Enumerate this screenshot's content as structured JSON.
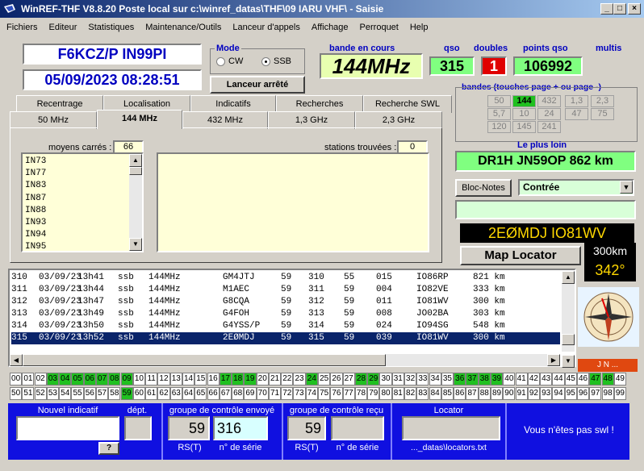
{
  "window": {
    "title": "WinREF-THF V8.8.20 Poste local sur c:\\winref_datas\\THF\\09 IARU VHF\\ -  Saisie"
  },
  "menu": [
    "Fichiers",
    "Editeur",
    "Statistiques",
    "Maintenance/Outils",
    "Lanceur d'appels",
    "Affichage",
    "Perroquet",
    "Help"
  ],
  "station": {
    "call_locator": "F6KCZ/P  IN99PI",
    "datetime": "05/09/2023  08:28:51"
  },
  "mode": {
    "label": "Mode",
    "options": [
      "CW",
      "SSB"
    ],
    "selected": "SSB"
  },
  "lanceur": "Lanceur arrêté",
  "band": {
    "label": "bande en cours",
    "value": "144MHz"
  },
  "qso": {
    "label": "qso",
    "value": "315"
  },
  "doubles": {
    "label": "doubles",
    "value": "1"
  },
  "points": {
    "label": "points qso",
    "value": "106992"
  },
  "multis": {
    "label": "multis"
  },
  "bandes": {
    "label": "bandes (touches page + ou page -)",
    "row1": [
      "50",
      "144",
      "432",
      "1,3",
      "2,3"
    ],
    "row2": [
      "5,7",
      "10",
      "24",
      "47",
      "75"
    ],
    "row3": [
      "120",
      "145",
      "241"
    ]
  },
  "tabs_top": [
    "Recentrage",
    "Localisation",
    "Indicatifs",
    "Recherches",
    "Recherche SWL"
  ],
  "tabs_bottom": [
    "50 MHz",
    "144 MHz",
    "432 MHz",
    "1,3 GHz",
    "2,3 GHz"
  ],
  "squares": {
    "label": "moyens carrés :",
    "count": "66",
    "items": [
      "IN73",
      "IN77",
      "IN83",
      "IN87",
      "IN88",
      "IN93",
      "IN94",
      "IN95"
    ]
  },
  "stations": {
    "label": "stations trouvées :",
    "count": "0"
  },
  "farthest": {
    "label": "Le plus loin",
    "value": "DR1H JN59OP  862 km"
  },
  "blocnotes": "Bloc-Notes",
  "contree": "Contrée",
  "current": {
    "call_loc": "2EØMDJ   IO81WV",
    "dist": "300km",
    "azimuth": "342°"
  },
  "maplocator": "Map Locator",
  "compass_label": "J N ...",
  "log": [
    {
      "n": "310",
      "date": "03/09/23",
      "time": "13h41",
      "mode": "ssb",
      "band": "144MHz",
      "call": "GM4JTJ",
      "rs": "59",
      "sn": "310",
      "rr": "55",
      "rn": "015",
      "loc": "IO86RP",
      "km": "821 km"
    },
    {
      "n": "311",
      "date": "03/09/23",
      "time": "13h44",
      "mode": "ssb",
      "band": "144MHz",
      "call": "M1AEC",
      "rs": "59",
      "sn": "311",
      "rr": "59",
      "rn": "004",
      "loc": "IO82VE",
      "km": "333 km"
    },
    {
      "n": "312",
      "date": "03/09/23",
      "time": "13h47",
      "mode": "ssb",
      "band": "144MHz",
      "call": "G8CQA",
      "rs": "59",
      "sn": "312",
      "rr": "59",
      "rn": "011",
      "loc": "IO81WV",
      "km": "300 km"
    },
    {
      "n": "313",
      "date": "03/09/23",
      "time": "13h49",
      "mode": "ssb",
      "band": "144MHz",
      "call": "G4FOH",
      "rs": "59",
      "sn": "313",
      "rr": "59",
      "rn": "008",
      "loc": "JO02BA",
      "km": "303 km"
    },
    {
      "n": "314",
      "date": "03/09/23",
      "time": "13h50",
      "mode": "ssb",
      "band": "144MHz",
      "call": "G4YSS/P",
      "rs": "59",
      "sn": "314",
      "rr": "59",
      "rn": "024",
      "loc": "IO94SG",
      "km": "548 km"
    },
    {
      "n": "315",
      "date": "03/09/23",
      "time": "13h52",
      "mode": "ssb",
      "band": "144MHz",
      "call": "2EØMDJ",
      "rs": "59",
      "sn": "315",
      "rr": "59",
      "rn": "039",
      "loc": "IO81WV",
      "km": "300 km"
    }
  ],
  "numbers_row1": [
    "00",
    "01",
    "02",
    "03",
    "04",
    "05",
    "06",
    "07",
    "08",
    "09",
    "10",
    "11",
    "12",
    "13",
    "14",
    "15",
    "16",
    "17",
    "18",
    "19",
    "20",
    "21",
    "22",
    "23",
    "24",
    "25",
    "26",
    "27",
    "28",
    "29",
    "30",
    "31",
    "32",
    "33",
    "34",
    "35",
    "36",
    "37",
    "38",
    "39",
    "40",
    "41",
    "42",
    "43",
    "44",
    "45",
    "46",
    "47",
    "48",
    "49"
  ],
  "numbers_row2": [
    "50",
    "51",
    "52",
    "53",
    "54",
    "55",
    "56",
    "57",
    "58",
    "59",
    "60",
    "61",
    "62",
    "63",
    "64",
    "65",
    "66",
    "67",
    "68",
    "69",
    "70",
    "71",
    "72",
    "73",
    "74",
    "75",
    "76",
    "77",
    "78",
    "79",
    "80",
    "81",
    "82",
    "83",
    "84",
    "85",
    "86",
    "87",
    "88",
    "89",
    "90",
    "91",
    "92",
    "93",
    "94",
    "95",
    "96",
    "97",
    "98",
    "99"
  ],
  "green_row1": [
    "03",
    "04",
    "05",
    "06",
    "07",
    "08",
    "09",
    "17",
    "18",
    "19",
    "24",
    "28",
    "29",
    "36",
    "37",
    "38",
    "39",
    "47",
    "48"
  ],
  "green_row2": [
    "59"
  ],
  "bottom": {
    "nouvel": "Nouvel indicatif",
    "dept": "dépt.",
    "help": "?",
    "groupe_envoye": "groupe de contrôle envoyé",
    "rs_sent": "59",
    "serial_sent": "316",
    "rst_label": "RS(T)",
    "serie_label": "n° de série",
    "groupe_recu": "groupe de contrôle reçu",
    "rs_recv": "59",
    "locator": "Locator",
    "locator_file": "..._datas\\locators.txt",
    "swl": "Vous n'êtes pas swl !"
  },
  "colors": {
    "green": "#80ff80",
    "blue_panel": "#1010e0",
    "highlight": "#0a246a"
  }
}
